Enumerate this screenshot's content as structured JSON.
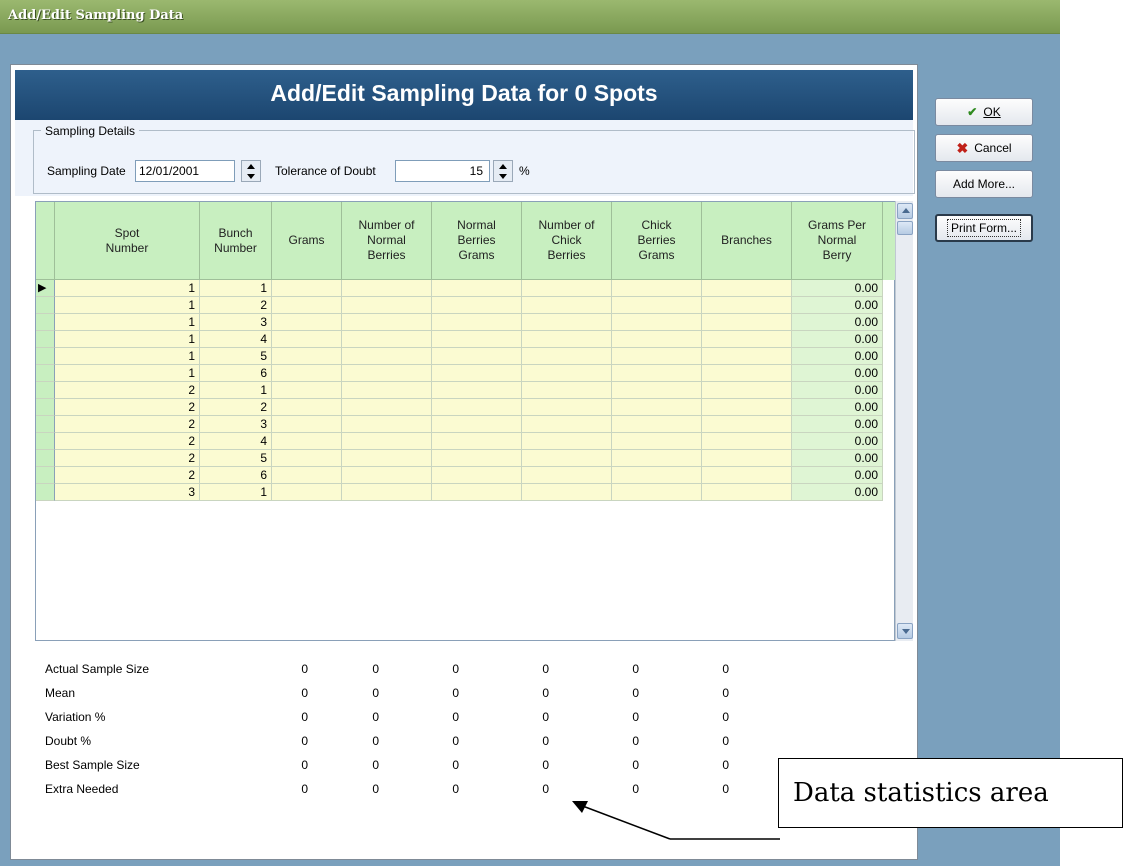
{
  "window": {
    "title": "Add/Edit Sampling Data"
  },
  "header": {
    "title": "Add/Edit Sampling Data for 0 Spots"
  },
  "details": {
    "legend": "Sampling Details",
    "date_label": "Sampling Date",
    "date_value": "12/01/2001",
    "tolerance_label": "Tolerance of Doubt",
    "tolerance_value": "15",
    "tolerance_unit": "%"
  },
  "grid": {
    "columns": [
      "Spot\nNumber",
      "Bunch\nNumber",
      "Grams",
      "Number of\nNormal\nBerries",
      "Normal\nBerries\nGrams",
      "Number of\nChick\nBerries",
      "Chick\nBerries\nGrams",
      "Branches",
      "Grams Per\nNormal\nBerry"
    ],
    "rows": [
      [
        "1",
        "1",
        "0.00"
      ],
      [
        "1",
        "2",
        "0.00"
      ],
      [
        "1",
        "3",
        "0.00"
      ],
      [
        "1",
        "4",
        "0.00"
      ],
      [
        "1",
        "5",
        "0.00"
      ],
      [
        "1",
        "6",
        "0.00"
      ],
      [
        "2",
        "1",
        "0.00"
      ],
      [
        "2",
        "2",
        "0.00"
      ],
      [
        "2",
        "3",
        "0.00"
      ],
      [
        "2",
        "4",
        "0.00"
      ],
      [
        "2",
        "5",
        "0.00"
      ],
      [
        "2",
        "6",
        "0.00"
      ],
      [
        "3",
        "1",
        "0.00"
      ]
    ]
  },
  "stats": {
    "rows": [
      {
        "label": "Actual Sample Size",
        "values": [
          "0",
          "0",
          "0",
          "0",
          "0",
          "0"
        ]
      },
      {
        "label": "Mean",
        "values": [
          "0",
          "0",
          "0",
          "0",
          "0",
          "0"
        ]
      },
      {
        "label": "Variation %",
        "values": [
          "0",
          "0",
          "0",
          "0",
          "0",
          "0"
        ]
      },
      {
        "label": "Doubt %",
        "values": [
          "0",
          "0",
          "0",
          "0",
          "0",
          "0"
        ]
      },
      {
        "label": "Best Sample Size",
        "values": [
          "0",
          "0",
          "0",
          "0",
          "0",
          "0"
        ]
      },
      {
        "label": "Extra Needed",
        "values": [
          "0",
          "0",
          "0",
          "0",
          "0",
          "0"
        ]
      }
    ]
  },
  "buttons": {
    "ok": "OK",
    "cancel": "Cancel",
    "add_more": "Add More...",
    "print_form": "Print Form..."
  },
  "callout": {
    "text": "Data statistics area"
  },
  "colors": {
    "accent": "#1c4670",
    "grid_header": "#c8efc0",
    "cell_yellow": "#fbfbd2",
    "cell_green": "#dff5d4"
  }
}
